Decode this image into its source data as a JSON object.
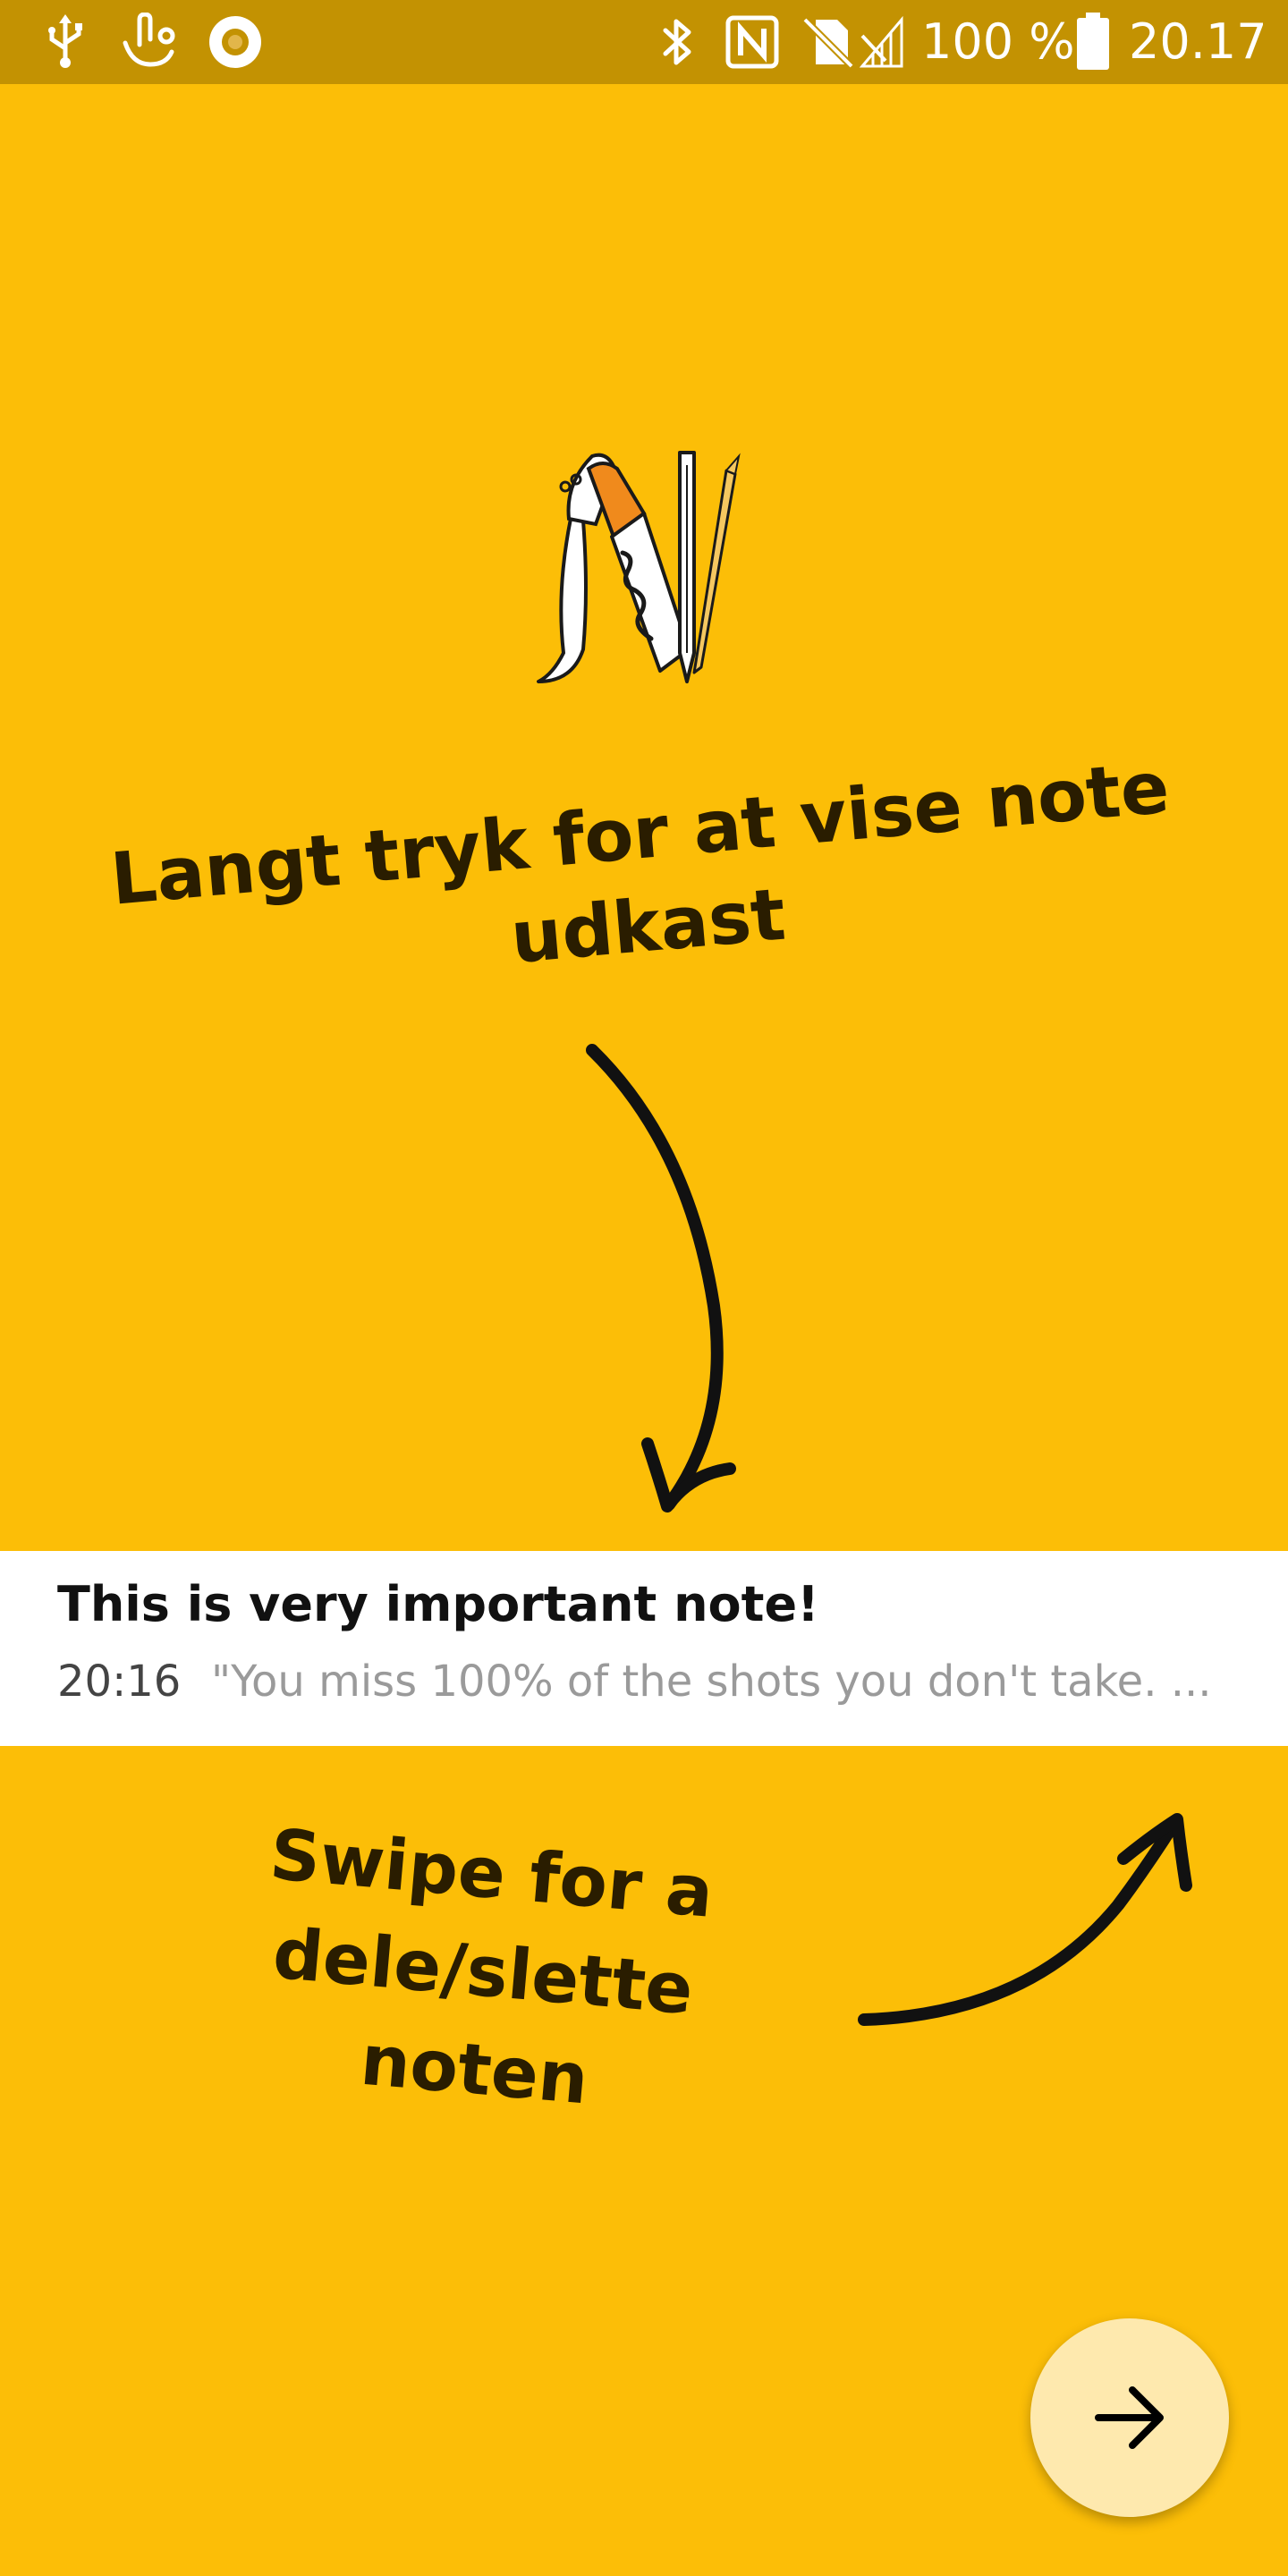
{
  "status_bar": {
    "battery_percent": "100 %",
    "clock": "20.17",
    "left_icons": [
      "usb-icon",
      "touch-gesture-icon",
      "record-icon"
    ],
    "right_icons": [
      "bluetooth-icon",
      "nfc-icon",
      "no-sim-icon",
      "no-signal-icon",
      "battery-icon"
    ]
  },
  "onboarding": {
    "logo_icon": "notes-app-logo",
    "long_press_hint_line1": "Langt tryk for at vise note",
    "long_press_hint_line2": "udkast",
    "swipe_hint_line1": "Swipe for a",
    "swipe_hint_line2": "dele/slette",
    "swipe_hint_line3": "noten"
  },
  "example_note": {
    "title": "This is very important note!",
    "time": "20:16",
    "preview": "\"You miss 100% of the shots you don't take. ..."
  },
  "next_button": {
    "icon": "arrow-right-icon"
  },
  "colors": {
    "background": "#FCBE07",
    "status_bar": "#C39202",
    "card": "#FFFFFF",
    "fab": "#FEE9AE",
    "hint_text": "#2A1D00"
  }
}
